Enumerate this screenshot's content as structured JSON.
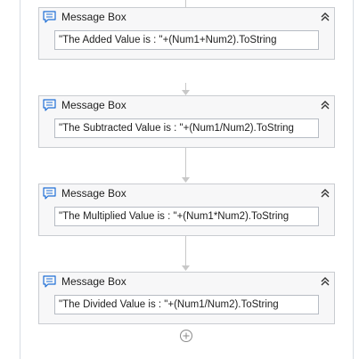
{
  "workflow": {
    "activities": [
      {
        "title": "Message Box",
        "text": "\"The Added Value is : \"+(Num1+Num2).ToString"
      },
      {
        "title": "Message Box",
        "text": "\"The Subtracted Value is : \"+(Num1/Num2).ToString"
      },
      {
        "title": "Message Box",
        "text": "\"The Multiplied Value is : \"+(Num1*Num2).ToString"
      },
      {
        "title": "Message Box",
        "text": "\"The Divided Value is : \"+(Num1/Num2).ToString"
      }
    ],
    "icons": {
      "activity": "message-box-icon",
      "collapse": "collapse-chevron-icon",
      "add": "add-activity-icon"
    },
    "colors": {
      "icon_blue": "#1f6fd6",
      "connector_gray": "#c8c8c8"
    }
  }
}
